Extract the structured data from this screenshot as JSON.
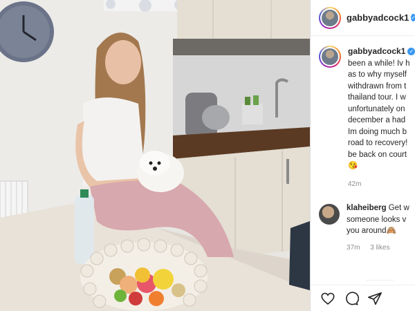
{
  "post": {
    "username": "gabbyadcock1",
    "verified_icon": "verified-badge-icon",
    "photo_alt": "Woman sitting on a kitchen counter holding a small white dog, bowl of fruit in foreground"
  },
  "caption": {
    "username": "gabbyadcock1",
    "lines": [
      "been a while! Iv h",
      "as to why myself",
      "withdrawn from t",
      "thailand tour. I w",
      "unfortunately on",
      "december a had",
      "Im doing much b",
      "road to recovery!",
      "be back on court"
    ],
    "emoji": "😘",
    "age": "42m"
  },
  "comment": {
    "username": "klaheiberg",
    "lines": [
      "Get w",
      "someone looks v",
      "you around"
    ],
    "emoji": "🙈",
    "time": "37m",
    "likes": "3 likes"
  },
  "actions": {
    "like": "heart-icon",
    "comment": "comment-icon",
    "share": "share-icon"
  },
  "colors": {
    "verified": "#3897f0",
    "text": "#262626",
    "muted": "#8e8e8e",
    "divider": "#efefef"
  }
}
